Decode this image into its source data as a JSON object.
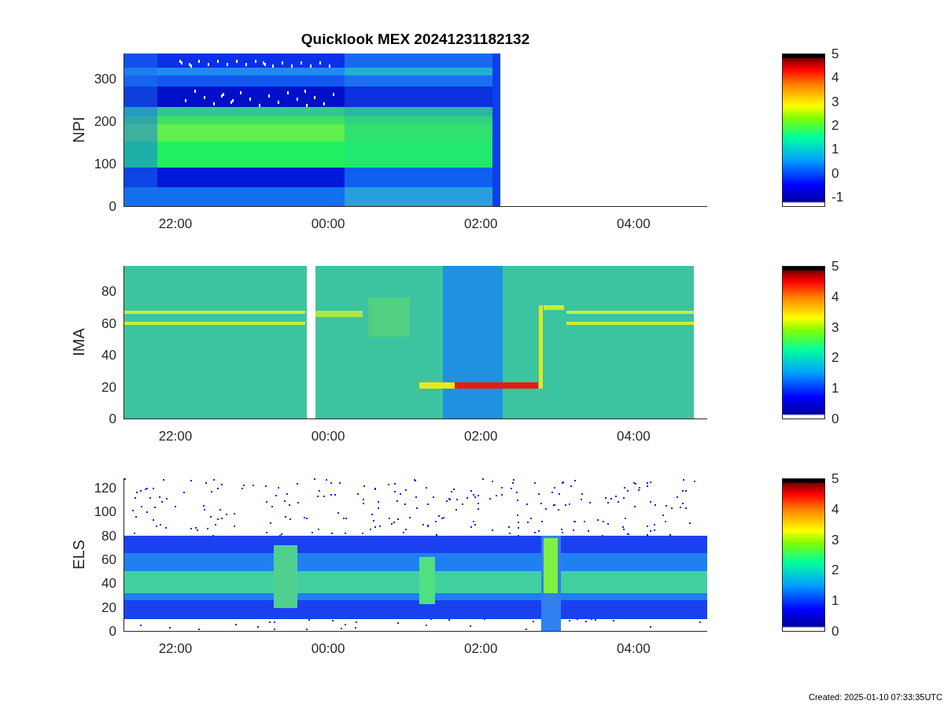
{
  "title": "Quicklook MEX 20241231182132",
  "panels": [
    {
      "kind": "npi",
      "ylabel": "NPI",
      "yticks": [
        "300",
        "200",
        "100",
        "0"
      ],
      "xticks": [
        "22:00",
        "00:00",
        "02:00",
        "04:00"
      ],
      "colorbar_ticks": [
        "5",
        "4",
        "3",
        "2",
        "1",
        "0",
        "-1"
      ]
    },
    {
      "kind": "ima",
      "ylabel": "IMA",
      "yticks": [
        "80",
        "60",
        "40",
        "20",
        "0"
      ],
      "xticks": [
        "22:00",
        "00:00",
        "02:00",
        "04:00"
      ],
      "colorbar_ticks": [
        "5",
        "4",
        "3",
        "2",
        "1",
        "0"
      ]
    },
    {
      "kind": "els",
      "ylabel": "ELS",
      "yticks": [
        "120",
        "100",
        "80",
        "60",
        "40",
        "20",
        "0"
      ],
      "xticks": [
        "22:00",
        "00:00",
        "02:00",
        "04:00"
      ],
      "colorbar_ticks": [
        "5",
        "4",
        "3",
        "2",
        "1",
        "0"
      ]
    }
  ],
  "footer": "Created: 2025-01-10 07:33:35UTC"
}
